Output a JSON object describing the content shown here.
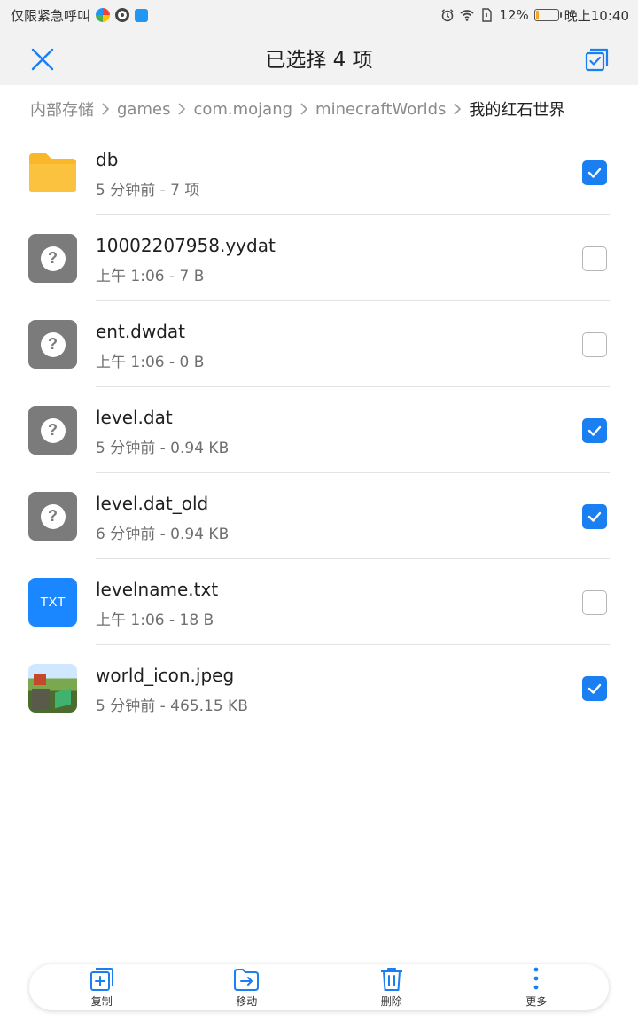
{
  "status_bar": {
    "carrier_text": "仅限紧急呼叫",
    "battery_percent": "12%",
    "battery_level": 0.12,
    "time": "晚上10:40"
  },
  "header": {
    "title": "已选择 4 项",
    "close_icon": "close-icon",
    "select_all_icon": "select-all-icon"
  },
  "breadcrumb": [
    "内部存储",
    "games",
    "com.mojang",
    "minecraftWorlds",
    "我的红石世界"
  ],
  "files": [
    {
      "name": "db",
      "meta": "5 分钟前 - 7 项",
      "type": "folder",
      "checked": true
    },
    {
      "name": "10002207958.yydat",
      "meta": "上午 1:06  - 7 B",
      "type": "unknown",
      "checked": false
    },
    {
      "name": "ent.dwdat",
      "meta": "上午 1:06  - 0 B",
      "type": "unknown",
      "checked": false
    },
    {
      "name": "level.dat",
      "meta": "5 分钟前 - 0.94 KB",
      "type": "unknown",
      "checked": true
    },
    {
      "name": "level.dat_old",
      "meta": "6 分钟前 - 0.94 KB",
      "type": "unknown",
      "checked": true
    },
    {
      "name": "levelname.txt",
      "meta": "上午 1:06  - 18 B",
      "type": "txt",
      "icon_text": "TXT",
      "checked": false
    },
    {
      "name": "world_icon.jpeg",
      "meta": "5 分钟前 - 465.15 KB",
      "type": "image",
      "checked": true
    }
  ],
  "actions": [
    {
      "label": "复制",
      "icon": "copy-icon"
    },
    {
      "label": "移动",
      "icon": "move-icon"
    },
    {
      "label": "删除",
      "icon": "delete-icon"
    },
    {
      "label": "更多",
      "icon": "more-icon"
    }
  ],
  "colors": {
    "accent": "#1a7ff0",
    "folder": "#f9b72a",
    "unknown_icon": "#7b7b7b",
    "txt_icon": "#1a86ff"
  }
}
